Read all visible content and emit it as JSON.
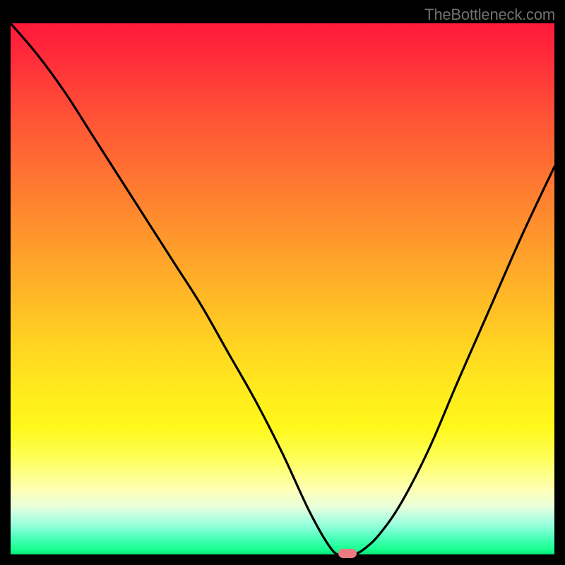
{
  "watermark": "TheBottleneck.com",
  "chart_data": {
    "type": "line",
    "title": "",
    "xlabel": "",
    "ylabel": "",
    "xrange": [
      0,
      100
    ],
    "yrange": [
      0,
      100
    ],
    "series": [
      {
        "name": "curve",
        "x": [
          0,
          5,
          10,
          15,
          20,
          25,
          30,
          35,
          40,
          45,
          50,
          55,
          59,
          61,
          63,
          65,
          68,
          72,
          77,
          82,
          88,
          94,
          100
        ],
        "y": [
          100,
          94,
          87,
          79,
          71,
          63,
          55,
          47,
          38,
          29,
          19,
          8,
          1,
          0,
          0,
          1,
          4,
          10,
          20,
          32,
          46,
          60,
          73
        ]
      }
    ],
    "marker": {
      "x": 62,
      "y": 0,
      "color": "#ee7b82"
    },
    "background_gradient": {
      "top": "#ff1a3a",
      "bottom": "#00e878"
    }
  }
}
